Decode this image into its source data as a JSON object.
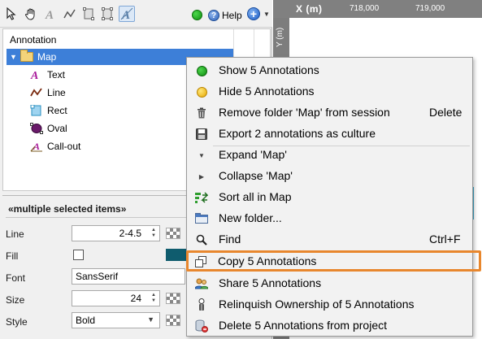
{
  "toolbar": {
    "help_label": "Help",
    "tools": [
      "select-tool",
      "pan-tool",
      "text-tool",
      "line-tool",
      "rect-tool",
      "oval-tool",
      "annotation-tool"
    ]
  },
  "tree": {
    "header": "Annotation",
    "folder": "Map",
    "children": [
      "Text",
      "Line",
      "Rect",
      "Oval",
      "Call-out"
    ]
  },
  "properties": {
    "title": "«multiple selected items»",
    "line_label": "Line",
    "line_value": "2-4.5",
    "fill_label": "Fill",
    "font_label": "Font",
    "font_value": "SansSerif",
    "size_label": "Size",
    "size_value": "24",
    "style_label": "Style",
    "style_value": "Bold",
    "fill_color": "#0f5c6e"
  },
  "map": {
    "x_axis_label": "X (m)",
    "x_ticks": [
      "718,000",
      "719,000"
    ],
    "y_axis_label": "Y (m)"
  },
  "context_menu": {
    "items": [
      {
        "label": "Show 5 Annotations",
        "icon": "green-dot-icon"
      },
      {
        "label": "Hide 5 Annotations",
        "icon": "yellow-dot-icon"
      },
      {
        "label": "Remove folder 'Map' from session",
        "icon": "trash-icon",
        "shortcut": "Delete"
      },
      {
        "label": "Export 2 annotations as culture",
        "icon": "save-icon"
      },
      {
        "label": "Expand 'Map'",
        "icon": "expand-icon"
      },
      {
        "label": "Collapse 'Map'",
        "icon": "collapse-icon"
      },
      {
        "label": "Sort all in Map",
        "icon": "sort-icon"
      },
      {
        "label": "New folder...",
        "icon": "new-folder-icon"
      },
      {
        "label": "Find",
        "icon": "magnifier-icon",
        "shortcut": "Ctrl+F"
      },
      {
        "label": "Copy 5 Annotations",
        "icon": "copy-icon"
      },
      {
        "label": "Share 5 Annotations",
        "icon": "share-icon"
      },
      {
        "label": "Relinquish Ownership of 5 Annotations",
        "icon": "relinquish-icon"
      },
      {
        "label": "Delete 5 Annotations from project",
        "icon": "delete-db-icon"
      }
    ]
  },
  "colors": {
    "selection": "#3d7fd8",
    "highlight_border": "#e8872e",
    "axis_bar": "#808080"
  }
}
